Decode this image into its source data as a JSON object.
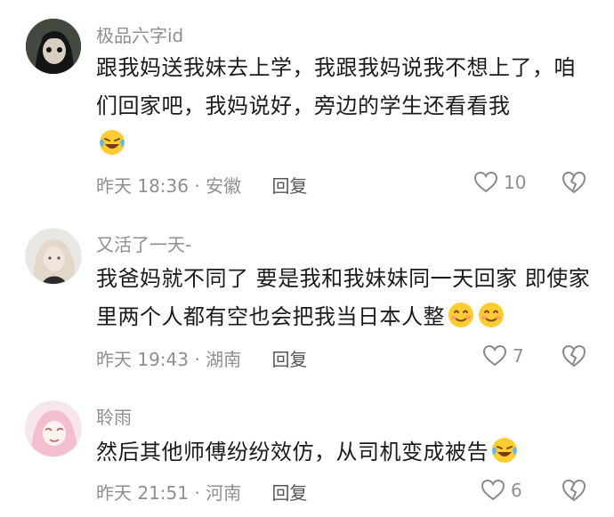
{
  "comments": [
    {
      "username": "极品六字id",
      "text": "跟我妈送我妹去上学，我跟我妈说我不想上了，咱们回家吧，我妈说好，旁边的学生还看看我",
      "emoji": [
        "laugh-cry-emoji"
      ],
      "meta": "昨天 18:36 · 安徽",
      "reply_label": "回复",
      "likes": "10"
    },
    {
      "username": "又活了一天-",
      "text": "我爸妈就不同了 要是我和我妹妹同一天回家 即使家里两个人都有空也会把我当日本人整",
      "emoji": [
        "smile-emoji",
        "smile-emoji"
      ],
      "meta": "昨天 19:43 · 湖南",
      "reply_label": "回复",
      "likes": "7"
    },
    {
      "username": "聆雨",
      "text": "然后其他师傅纷纷效仿，从司机变成被告",
      "emoji": [
        "laugh-cry-emoji"
      ],
      "meta": "昨天 21:51 · 河南",
      "reply_label": "回复",
      "likes": "6"
    }
  ]
}
